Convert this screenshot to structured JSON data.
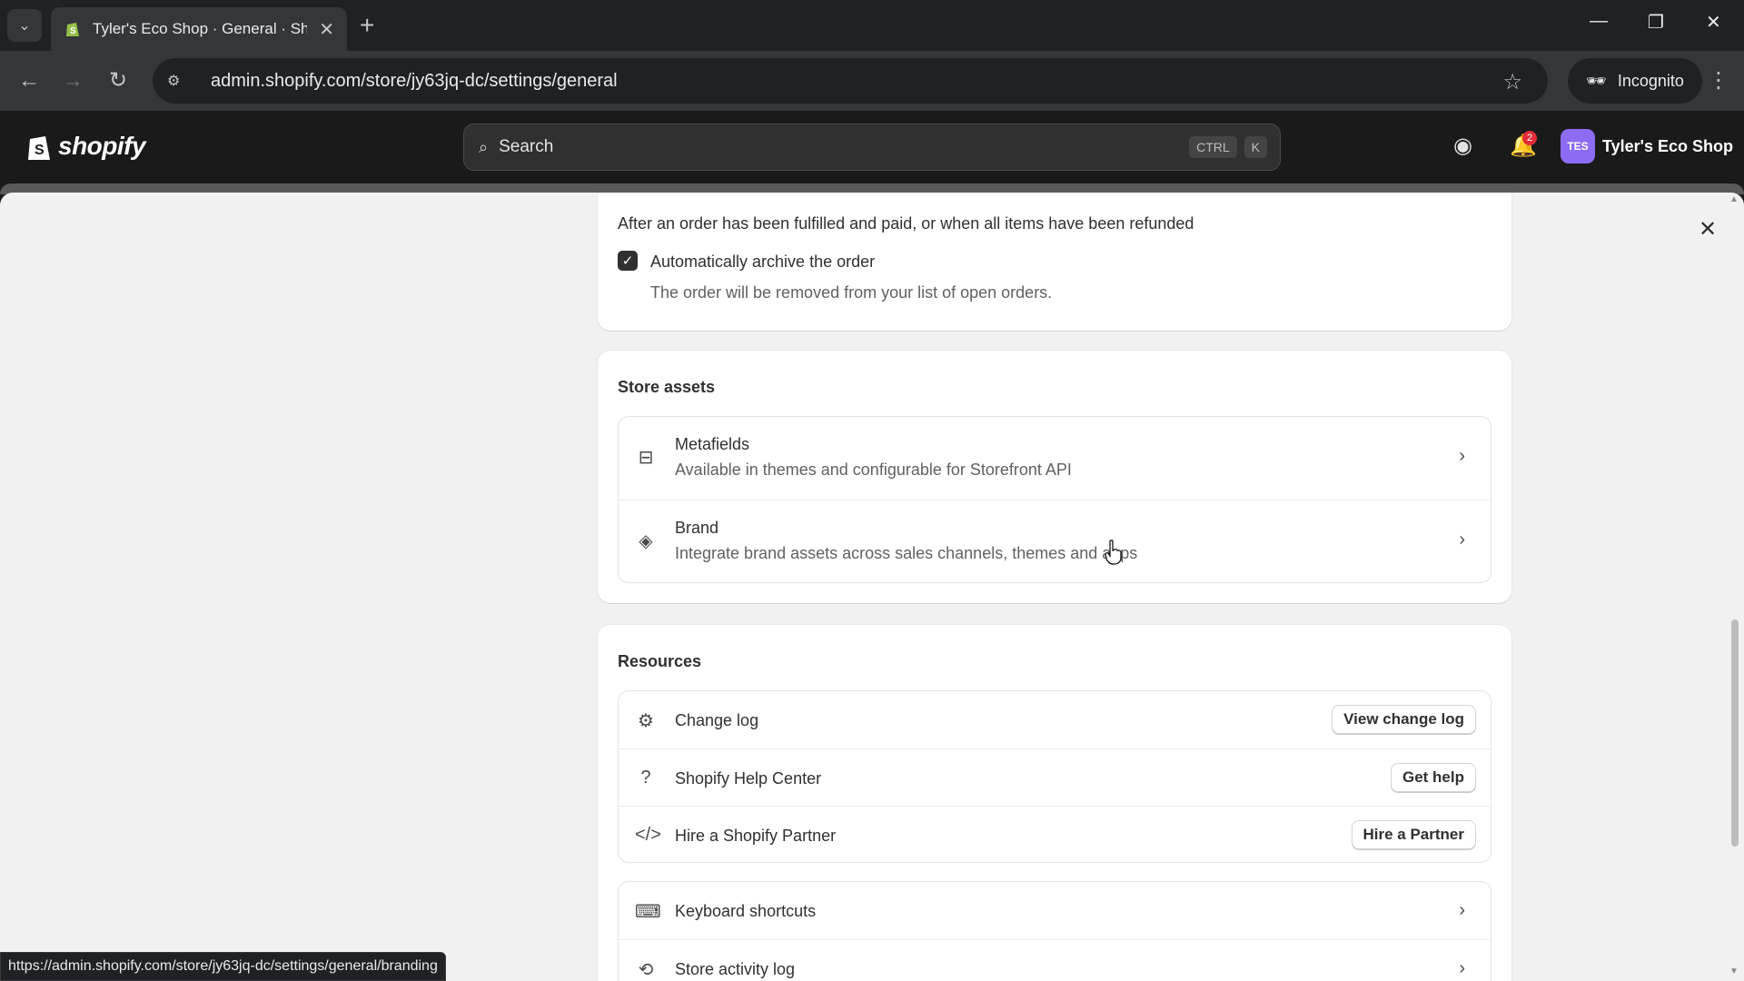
{
  "browser": {
    "tab_title": "Tyler's Eco Shop · General · Shopify",
    "url": "admin.shopify.com/store/jy63jq-dc/settings/general",
    "incognito_label": "Incognito",
    "status_url": "https://admin.shopify.com/store/jy63jq-dc/settings/general/branding"
  },
  "shopify_header": {
    "logo_text": "shopify",
    "search_placeholder": "Search",
    "shortcut_keys": [
      "CTRL",
      "K"
    ],
    "notification_count": "2",
    "avatar_initials": "TES",
    "store_name": "Tyler's Eco Shop"
  },
  "order_processing": {
    "description": "After an order has been fulfilled and paid, or when all items have been refunded",
    "checkbox_label": "Automatically archive the order",
    "checkbox_checked": true,
    "checkbox_help": "The order will be removed from your list of open orders."
  },
  "store_assets": {
    "title": "Store assets",
    "items": [
      {
        "icon": "metafields-icon",
        "title": "Metafields",
        "subtitle": "Available in themes and configurable for Storefront API"
      },
      {
        "icon": "brand-icon",
        "title": "Brand",
        "subtitle": "Integrate brand assets across sales channels, themes and apps"
      }
    ]
  },
  "resources": {
    "title": "Resources",
    "items": [
      {
        "icon": "change-log-icon",
        "title": "Change log",
        "button": "View change log"
      },
      {
        "icon": "help-icon",
        "title": "Shopify Help Center",
        "button": "Get help"
      },
      {
        "icon": "code-icon",
        "title": "Hire a Shopify Partner",
        "button": "Hire a Partner"
      }
    ],
    "links": [
      {
        "icon": "keyboard-icon",
        "title": "Keyboard shortcuts"
      },
      {
        "icon": "activity-log-icon",
        "title": "Store activity log"
      }
    ]
  },
  "colors": {
    "avatar_bg": "#8c6cf2",
    "badge_bg": "#e22c38",
    "header_bg": "#1a1a1a",
    "page_bg": "#f1f1f1"
  }
}
